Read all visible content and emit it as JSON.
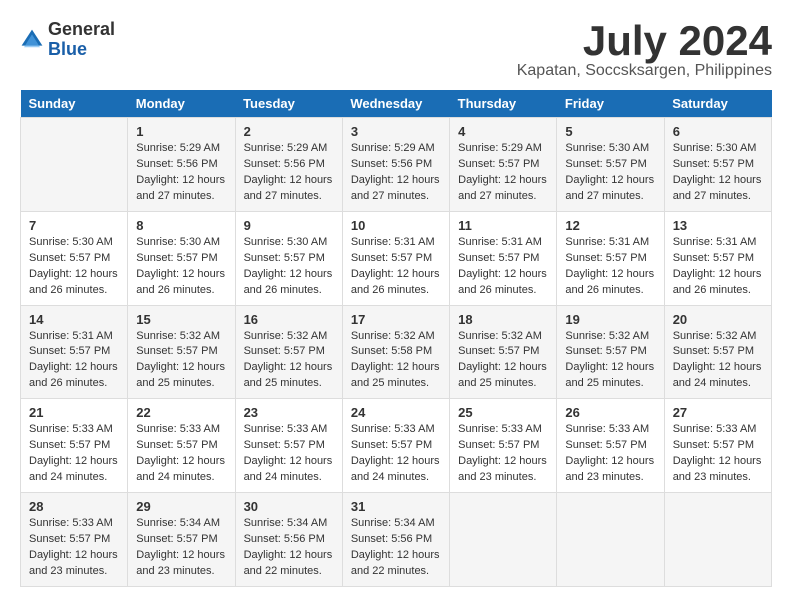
{
  "logo": {
    "general": "General",
    "blue": "Blue"
  },
  "title": "July 2024",
  "subtitle": "Kapatan, Soccsksargen, Philippines",
  "weekdays": [
    "Sunday",
    "Monday",
    "Tuesday",
    "Wednesday",
    "Thursday",
    "Friday",
    "Saturday"
  ],
  "weeks": [
    [
      {
        "day": "",
        "content": ""
      },
      {
        "day": "1",
        "content": "Sunrise: 5:29 AM\nSunset: 5:56 PM\nDaylight: 12 hours\nand 27 minutes."
      },
      {
        "day": "2",
        "content": "Sunrise: 5:29 AM\nSunset: 5:56 PM\nDaylight: 12 hours\nand 27 minutes."
      },
      {
        "day": "3",
        "content": "Sunrise: 5:29 AM\nSunset: 5:56 PM\nDaylight: 12 hours\nand 27 minutes."
      },
      {
        "day": "4",
        "content": "Sunrise: 5:29 AM\nSunset: 5:57 PM\nDaylight: 12 hours\nand 27 minutes."
      },
      {
        "day": "5",
        "content": "Sunrise: 5:30 AM\nSunset: 5:57 PM\nDaylight: 12 hours\nand 27 minutes."
      },
      {
        "day": "6",
        "content": "Sunrise: 5:30 AM\nSunset: 5:57 PM\nDaylight: 12 hours\nand 27 minutes."
      }
    ],
    [
      {
        "day": "7",
        "content": "Sunrise: 5:30 AM\nSunset: 5:57 PM\nDaylight: 12 hours\nand 26 minutes."
      },
      {
        "day": "8",
        "content": "Sunrise: 5:30 AM\nSunset: 5:57 PM\nDaylight: 12 hours\nand 26 minutes."
      },
      {
        "day": "9",
        "content": "Sunrise: 5:30 AM\nSunset: 5:57 PM\nDaylight: 12 hours\nand 26 minutes."
      },
      {
        "day": "10",
        "content": "Sunrise: 5:31 AM\nSunset: 5:57 PM\nDaylight: 12 hours\nand 26 minutes."
      },
      {
        "day": "11",
        "content": "Sunrise: 5:31 AM\nSunset: 5:57 PM\nDaylight: 12 hours\nand 26 minutes."
      },
      {
        "day": "12",
        "content": "Sunrise: 5:31 AM\nSunset: 5:57 PM\nDaylight: 12 hours\nand 26 minutes."
      },
      {
        "day": "13",
        "content": "Sunrise: 5:31 AM\nSunset: 5:57 PM\nDaylight: 12 hours\nand 26 minutes."
      }
    ],
    [
      {
        "day": "14",
        "content": "Sunrise: 5:31 AM\nSunset: 5:57 PM\nDaylight: 12 hours\nand 26 minutes."
      },
      {
        "day": "15",
        "content": "Sunrise: 5:32 AM\nSunset: 5:57 PM\nDaylight: 12 hours\nand 25 minutes."
      },
      {
        "day": "16",
        "content": "Sunrise: 5:32 AM\nSunset: 5:57 PM\nDaylight: 12 hours\nand 25 minutes."
      },
      {
        "day": "17",
        "content": "Sunrise: 5:32 AM\nSunset: 5:58 PM\nDaylight: 12 hours\nand 25 minutes."
      },
      {
        "day": "18",
        "content": "Sunrise: 5:32 AM\nSunset: 5:57 PM\nDaylight: 12 hours\nand 25 minutes."
      },
      {
        "day": "19",
        "content": "Sunrise: 5:32 AM\nSunset: 5:57 PM\nDaylight: 12 hours\nand 25 minutes."
      },
      {
        "day": "20",
        "content": "Sunrise: 5:32 AM\nSunset: 5:57 PM\nDaylight: 12 hours\nand 24 minutes."
      }
    ],
    [
      {
        "day": "21",
        "content": "Sunrise: 5:33 AM\nSunset: 5:57 PM\nDaylight: 12 hours\nand 24 minutes."
      },
      {
        "day": "22",
        "content": "Sunrise: 5:33 AM\nSunset: 5:57 PM\nDaylight: 12 hours\nand 24 minutes."
      },
      {
        "day": "23",
        "content": "Sunrise: 5:33 AM\nSunset: 5:57 PM\nDaylight: 12 hours\nand 24 minutes."
      },
      {
        "day": "24",
        "content": "Sunrise: 5:33 AM\nSunset: 5:57 PM\nDaylight: 12 hours\nand 24 minutes."
      },
      {
        "day": "25",
        "content": "Sunrise: 5:33 AM\nSunset: 5:57 PM\nDaylight: 12 hours\nand 23 minutes."
      },
      {
        "day": "26",
        "content": "Sunrise: 5:33 AM\nSunset: 5:57 PM\nDaylight: 12 hours\nand 23 minutes."
      },
      {
        "day": "27",
        "content": "Sunrise: 5:33 AM\nSunset: 5:57 PM\nDaylight: 12 hours\nand 23 minutes."
      }
    ],
    [
      {
        "day": "28",
        "content": "Sunrise: 5:33 AM\nSunset: 5:57 PM\nDaylight: 12 hours\nand 23 minutes."
      },
      {
        "day": "29",
        "content": "Sunrise: 5:34 AM\nSunset: 5:57 PM\nDaylight: 12 hours\nand 23 minutes."
      },
      {
        "day": "30",
        "content": "Sunrise: 5:34 AM\nSunset: 5:56 PM\nDaylight: 12 hours\nand 22 minutes."
      },
      {
        "day": "31",
        "content": "Sunrise: 5:34 AM\nSunset: 5:56 PM\nDaylight: 12 hours\nand 22 minutes."
      },
      {
        "day": "",
        "content": ""
      },
      {
        "day": "",
        "content": ""
      },
      {
        "day": "",
        "content": ""
      }
    ]
  ]
}
